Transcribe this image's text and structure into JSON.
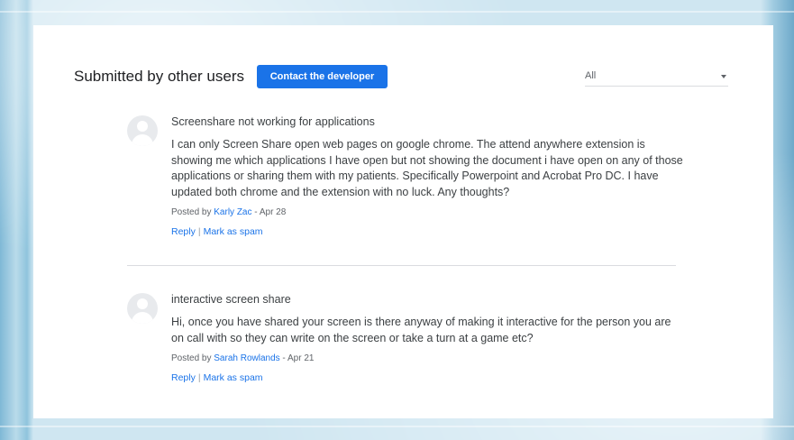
{
  "header": {
    "title": "Submitted by other users",
    "contact_button": "Contact the developer",
    "filter": {
      "selected": "All"
    }
  },
  "reviews": [
    {
      "title": "Screenshare not working for applications",
      "body": "I can only Screen Share open web pages on google chrome. The attend anywhere extension is showing me which applications I have open but not showing the document i have open on any of those applications or sharing them with my patients. Specifically Powerpoint and Acrobat Pro DC. I have updated both chrome and the extension with no luck. Any thoughts?",
      "posted_by_label": "Posted by",
      "author": "Karly Zac",
      "date": "- Apr 28",
      "reply_label": "Reply",
      "separator": "|",
      "spam_label": "Mark as spam"
    },
    {
      "title": "interactive screen share",
      "body": "Hi, once you have shared your screen is there anyway of making it interactive for the person you are on call with so they can write on the screen or take a turn at a game etc?",
      "posted_by_label": "Posted by",
      "author": "Sarah Rowlands",
      "date": "- Apr 21",
      "reply_label": "Reply",
      "separator": "|",
      "spam_label": "Mark as spam"
    }
  ],
  "colors": {
    "accent": "#1a73e8",
    "text": "#3c4043",
    "muted": "#5f6368",
    "divider": "#dadce0"
  },
  "icons": {
    "avatar": "user-avatar-icon",
    "dropdown": "chevron-down-icon"
  }
}
